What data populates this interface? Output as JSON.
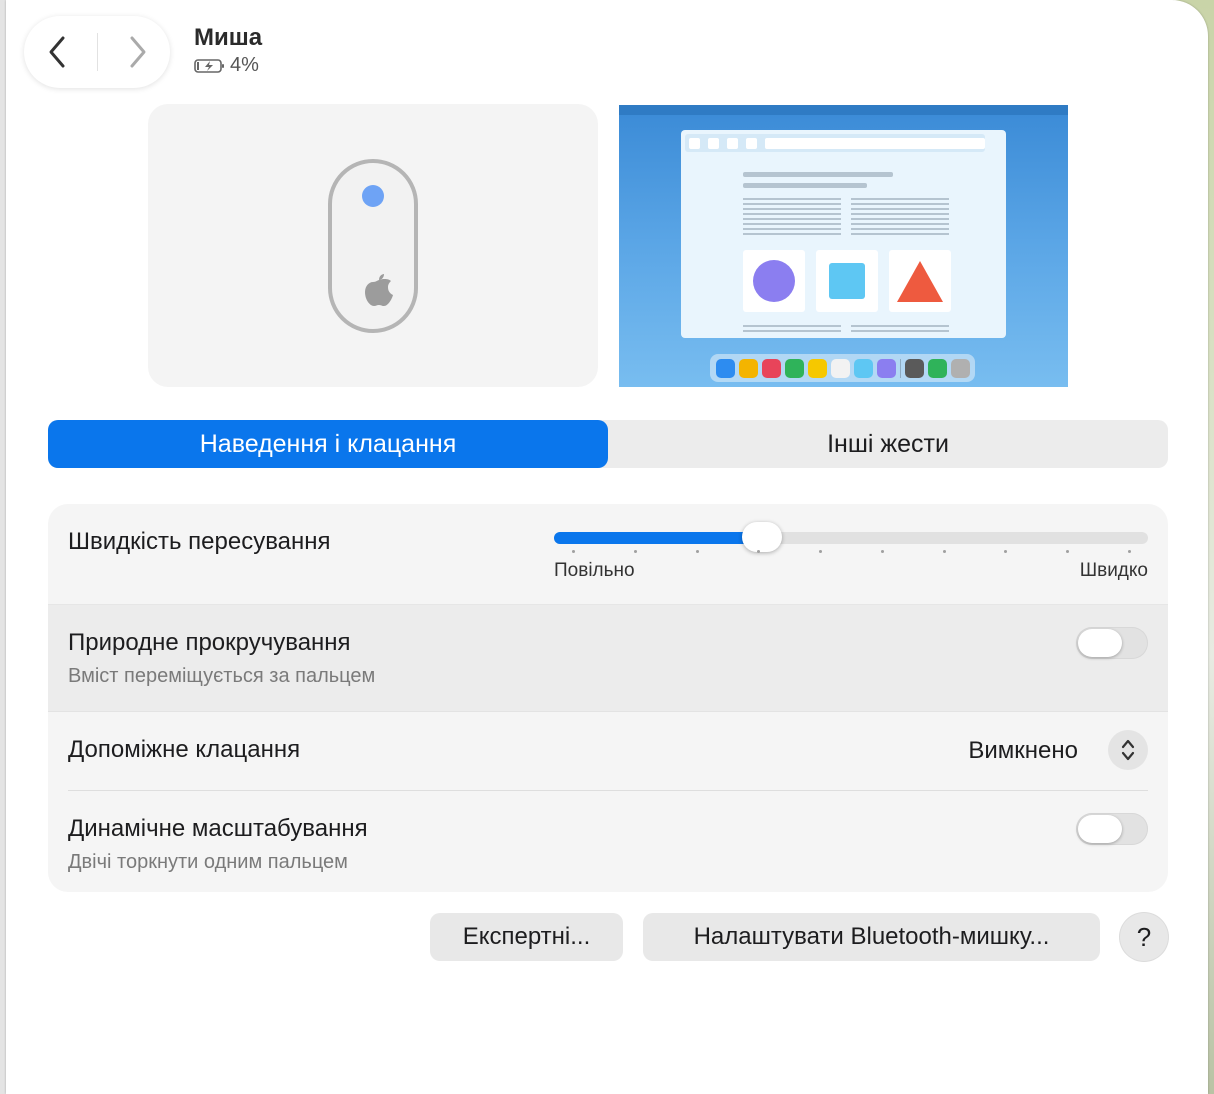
{
  "header": {
    "title": "Миша",
    "battery_level": "4%",
    "back_icon": "chevron-left-icon",
    "forward_icon": "chevron-right-icon"
  },
  "tabs": [
    {
      "label": "Наведення і клацання",
      "active": true
    },
    {
      "label": "Інші жести",
      "active": false
    }
  ],
  "settings": {
    "tracking_speed": {
      "label": "Швидкість пересування",
      "min_label": "Повільно",
      "max_label": "Швидко",
      "value_fraction": 0.35,
      "tick_count": 10
    },
    "natural_scrolling": {
      "label": "Природне прокручування",
      "description": "Вміст переміщується за пальцем",
      "enabled": false
    },
    "secondary_click": {
      "label": "Допоміжне клацання",
      "value": "Вимкнено"
    },
    "smart_zoom": {
      "label": "Динамічне масштабування",
      "description": "Двічі торкнути одним пальцем",
      "enabled": false
    }
  },
  "buttons": {
    "advanced": "Експертні...",
    "bluetooth_setup": "Налаштувати Bluetooth-мишку...",
    "help": "?"
  },
  "colors": {
    "accent": "#0a76ec",
    "preview_highlight_dot": "#6ea3f5"
  }
}
